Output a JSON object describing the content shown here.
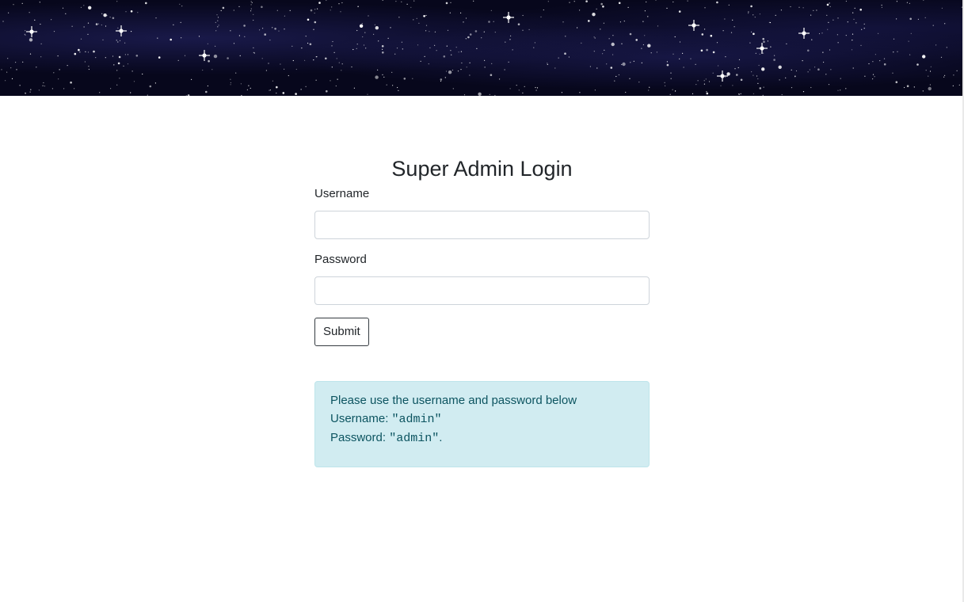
{
  "header": {
    "image": "starfield-banner"
  },
  "login": {
    "title": "Super Admin Login",
    "username_label": "Username",
    "username_value": "",
    "password_label": "Password",
    "password_value": "",
    "submit_label": "Submit"
  },
  "info": {
    "intro": "Please use the username and password below",
    "username_prefix": "Username: ",
    "username_code": "\"admin\"",
    "password_prefix": "Password: ",
    "password_code": "\"admin\"",
    "password_suffix": "."
  },
  "colors": {
    "alert_background": "#d1ecf1",
    "alert_text": "#0c5460",
    "alert_border": "#bee5eb",
    "banner_background": "#07071c"
  }
}
